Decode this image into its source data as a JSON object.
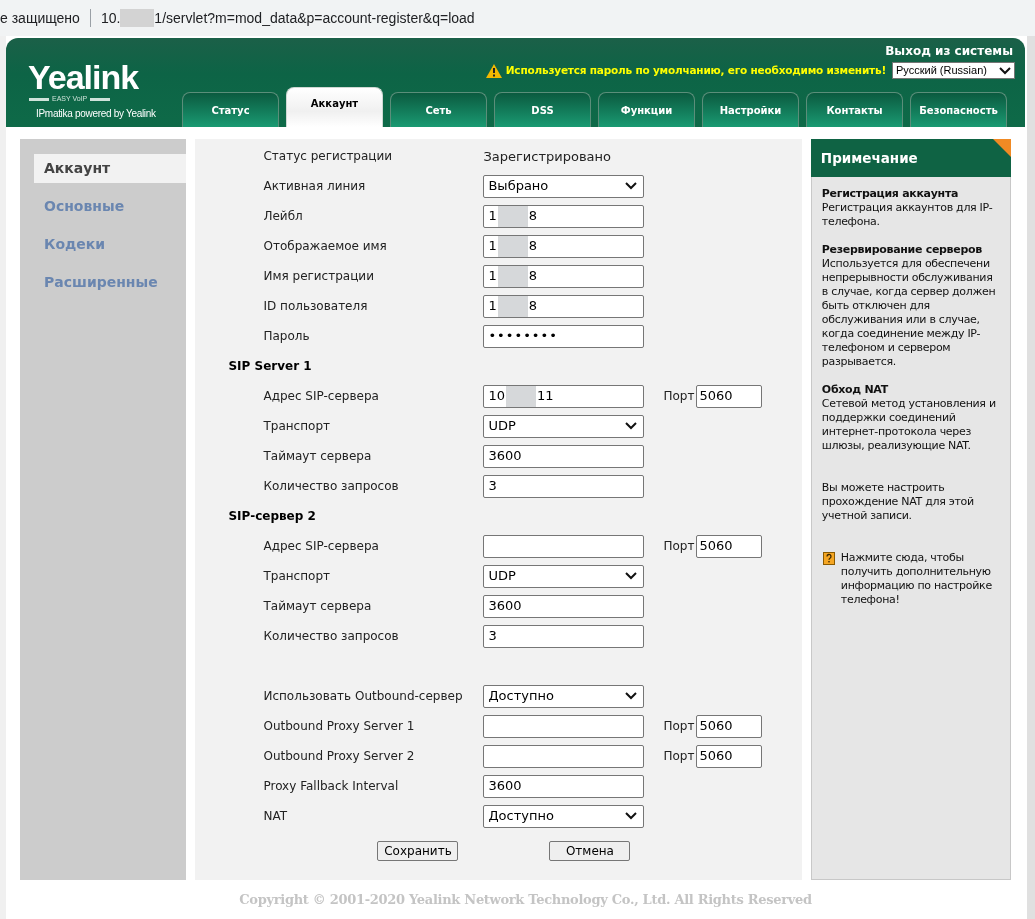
{
  "address_bar": {
    "security": "е защищено",
    "url_start": "10.",
    "url_end": "1/servlet?m=mod_data&p=account-register&q=load"
  },
  "header": {
    "logo": "Yealink",
    "logo_tagline": "EASY VoIP",
    "powered_by": "IPmatika powered by Yealink",
    "logout": "Выход из системы",
    "warning": "Используется пароль по умолчанию, его необходимо изменить!",
    "language": "Русский (Russian)"
  },
  "tabs": [
    {
      "label": "Статус",
      "selected": false
    },
    {
      "label": "Аккаунт",
      "selected": true
    },
    {
      "label": "Сеть",
      "selected": false
    },
    {
      "label": "DSS",
      "selected": false
    },
    {
      "label": "Функции",
      "selected": false
    },
    {
      "label": "Настройки",
      "selected": false
    },
    {
      "label": "Контакты",
      "selected": false
    },
    {
      "label": "Безопасность",
      "selected": false
    }
  ],
  "sidebar": {
    "items": [
      {
        "label": "Аккаунт",
        "selected": true
      },
      {
        "label": "Основные",
        "selected": false
      },
      {
        "label": "Кодеки",
        "selected": false
      },
      {
        "label": "Расширенные",
        "selected": false
      }
    ]
  },
  "form": {
    "groups": [
      {
        "rows": [
          {
            "kind": "text",
            "label": "Статус регистрации",
            "value": "Зарегистрировано"
          },
          {
            "kind": "select",
            "label": "Активная линия",
            "value": "Выбрано"
          },
          {
            "kind": "redacted",
            "label": "Лейбл",
            "value": [
              "1",
              "8"
            ]
          },
          {
            "kind": "redacted",
            "label": "Отображаемое имя",
            "value": [
              "1",
              "8"
            ]
          },
          {
            "kind": "redacted",
            "label": "Имя регистрации",
            "value": [
              "1",
              "8"
            ]
          },
          {
            "kind": "redacted",
            "label": "ID пользователя",
            "value": [
              "1",
              "8"
            ]
          },
          {
            "kind": "password",
            "label": "Пароль",
            "value": "••••••••"
          }
        ]
      },
      {
        "heading": "SIP Server 1",
        "rows": [
          {
            "kind": "redacted",
            "label": "Адрес SIP-сервера",
            "value": [
              "10",
              "11"
            ],
            "port_label": "Порт",
            "port": "5060"
          },
          {
            "kind": "select",
            "label": "Транспорт",
            "value": "UDP"
          },
          {
            "kind": "input",
            "label": "Таймаут сервера",
            "value": "3600"
          },
          {
            "kind": "input",
            "label": "Количество запросов",
            "value": "3"
          }
        ]
      },
      {
        "heading": "SIP-сервер 2",
        "rows": [
          {
            "kind": "input",
            "label": "Адрес SIP-сервера",
            "port_label": "Порт",
            "port": "5060"
          },
          {
            "kind": "select",
            "label": "Транспорт",
            "value": "UDP"
          },
          {
            "kind": "input",
            "label": "Таймаут сервера",
            "value": "3600"
          },
          {
            "kind": "input",
            "label": "Количество запросов",
            "value": "3"
          }
        ]
      },
      {
        "rows": [
          {
            "kind": "select",
            "label": "Использовать Outbound-сервер",
            "value": "Доступно"
          },
          {
            "kind": "input",
            "label": "Outbound Proxy Server 1",
            "port_label": "Порт",
            "port": "5060"
          },
          {
            "kind": "input",
            "label": "Outbound Proxy Server 2",
            "port_label": "Порт",
            "port": "5060"
          },
          {
            "kind": "input",
            "label": "Proxy Fallback Interval",
            "value": "3600"
          },
          {
            "kind": "select",
            "label": "NAT",
            "value": "Доступно"
          }
        ]
      }
    ],
    "buttons": [
      "Сохранить",
      "Отмена"
    ]
  },
  "note": {
    "title": "Примечание",
    "sections": [
      {
        "heading": "Регистрация аккаунта",
        "text": "Регистрация аккаунтов для IP-телефона."
      },
      {
        "heading": "Резервирование серверов",
        "text": "Используется для обеспечени непрерывности обслуживания в случае, когда сервер должен быть отключен для обслуживания или в случае, когда соединение между IP-телефоном и сервером разрывается."
      },
      {
        "heading": "Обход NAT",
        "text": "Сетевой метод установления и поддержки соединений интернет-протокола через шлюзы, реализующие NAT."
      },
      {
        "text": "Вы можете настроить прохождение NAT для этой учетной записи."
      }
    ],
    "help": "Нажмите сюда, чтобы получить дополнительную информацию по настройке телефона!"
  },
  "footer": "Copyright © 2001-2020 Yealink Network Technology Co., Ltd. All Rights Reserved"
}
